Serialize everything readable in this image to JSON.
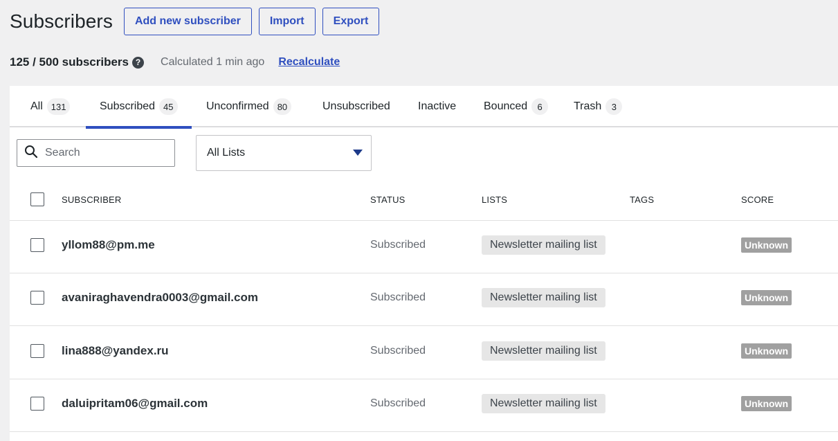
{
  "header": {
    "title": "Subscribers",
    "add_label": "Add new subscriber",
    "import_label": "Import",
    "export_label": "Export"
  },
  "summary": {
    "count": "125 / 500 subscribers",
    "help": "?",
    "calculated": "Calculated 1 min ago",
    "recalculate": "Recalculate"
  },
  "tabs": [
    {
      "label": "All",
      "count": "131"
    },
    {
      "label": "Subscribed",
      "count": "45"
    },
    {
      "label": "Unconfirmed",
      "count": "80"
    },
    {
      "label": "Unsubscribed",
      "count": ""
    },
    {
      "label": "Inactive",
      "count": ""
    },
    {
      "label": "Bounced",
      "count": "6"
    },
    {
      "label": "Trash",
      "count": "3"
    }
  ],
  "active_tab": "Subscribed",
  "search": {
    "placeholder": "Search",
    "value": ""
  },
  "list_filter": {
    "selected": "All Lists"
  },
  "columns": {
    "subscriber": "SUBSCRIBER",
    "status": "STATUS",
    "lists": "LISTS",
    "tags": "TAGS",
    "score": "SCORE"
  },
  "rows": [
    {
      "email": "yllom88@pm.me",
      "status": "Subscribed",
      "list": "Newsletter mailing list",
      "tags": "",
      "score": "Unknown"
    },
    {
      "email": "avaniraghavendra0003@gmail.com",
      "status": "Subscribed",
      "list": "Newsletter mailing list",
      "tags": "",
      "score": "Unknown"
    },
    {
      "email": "lina888@yandex.ru",
      "status": "Subscribed",
      "list": "Newsletter mailing list",
      "tags": "",
      "score": "Unknown"
    },
    {
      "email": "daluipritam06@gmail.com",
      "status": "Subscribed",
      "list": "Newsletter mailing list",
      "tags": "",
      "score": "Unknown"
    }
  ],
  "colors": {
    "accent": "#2f4fbf",
    "score_badge": "#a0a0a0",
    "list_tag": "#e6e6e6"
  }
}
